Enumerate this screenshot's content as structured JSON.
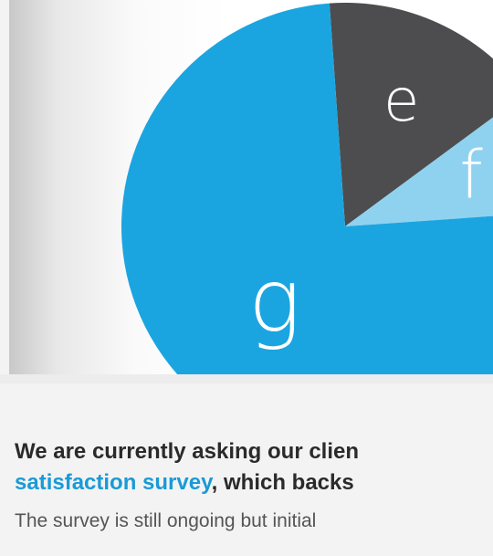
{
  "chart_data": {
    "type": "pie",
    "title": "",
    "slices": [
      {
        "label": "e",
        "share": 0.16,
        "color": "#4d4d4f"
      },
      {
        "label": "f",
        "share": 0.09,
        "color": "#8fd2f0"
      },
      {
        "label": "g",
        "share": 0.75,
        "color": "#1ba5e0"
      }
    ],
    "start_angle_deg": -94,
    "legend": "none",
    "slice_label_color": "#ffffff"
  },
  "intro": {
    "headline_part1": "We are currently asking our clien",
    "headline_link": "satisfaction survey",
    "headline_part2": ", which backs",
    "body_line1": "The survey is still ongoing but initial"
  },
  "colors": {
    "accent": "#1a9ad6",
    "heading": "#2a2a2a",
    "body": "#555555"
  }
}
